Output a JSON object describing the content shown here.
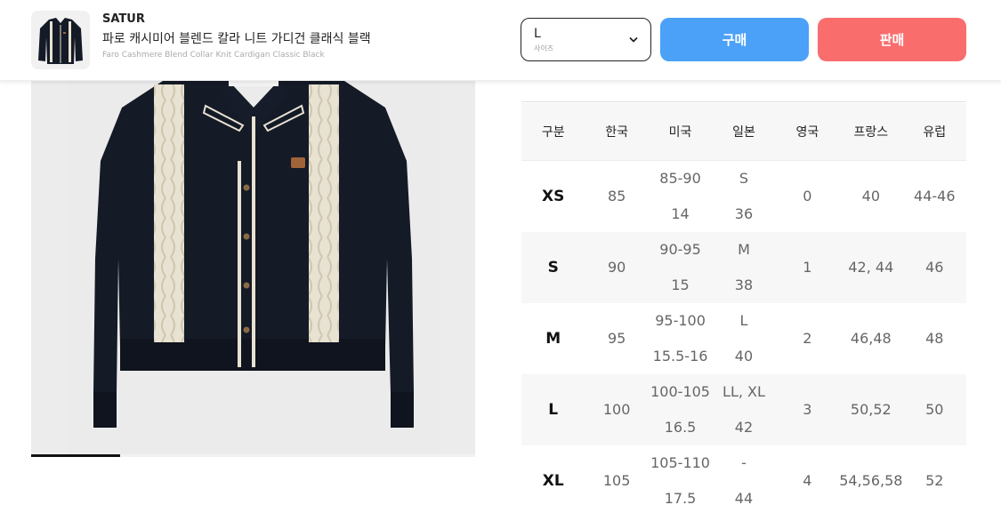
{
  "header": {
    "brand": "SATUR",
    "title_ko": "파로 캐시미어 블렌드 칼라 니트 가디건 클래식 블랙",
    "title_en": "Faro Cashmere Blend Collar Knit Cardigan Classic Black",
    "size_select": {
      "value": "L",
      "caption": "사이즈",
      "icon": "chevron-down-icon"
    },
    "buy_label": "구매",
    "sell_label": "판매",
    "colors": {
      "buy": "#4aa1f7",
      "sell": "#f96d6d"
    }
  },
  "gallery": {
    "image": "black-knit-cardigan-with-cream-cable-stripes",
    "slide_progress": 0.2
  },
  "size_table": {
    "headers": [
      "구분",
      "한국",
      "미국",
      "일본",
      "영국",
      "프랑스",
      "유럽"
    ],
    "rows": [
      {
        "code": "XS",
        "kr": "85",
        "us1": "85-90",
        "us2": "14",
        "jp1": "S",
        "jp2": "36",
        "uk": "0",
        "fr": "40",
        "eu": "44-46"
      },
      {
        "code": "S",
        "kr": "90",
        "us1": "90-95",
        "us2": "15",
        "jp1": "M",
        "jp2": "38",
        "uk": "1",
        "fr": "42, 44",
        "eu": "46"
      },
      {
        "code": "M",
        "kr": "95",
        "us1": "95-100",
        "us2": "15.5-16",
        "jp1": "L",
        "jp2": "40",
        "uk": "2",
        "fr": "46,48",
        "eu": "48"
      },
      {
        "code": "L",
        "kr": "100",
        "us1": "100-105",
        "us2": "16.5",
        "jp1": "LL, XL",
        "jp2": "42",
        "uk": "3",
        "fr": "50,52",
        "eu": "50"
      },
      {
        "code": "XL",
        "kr": "105",
        "us1": "105-110",
        "us2": "17.5",
        "jp1": "-",
        "jp2": "44",
        "uk": "4",
        "fr": "54,56,58",
        "eu": "52"
      }
    ]
  }
}
